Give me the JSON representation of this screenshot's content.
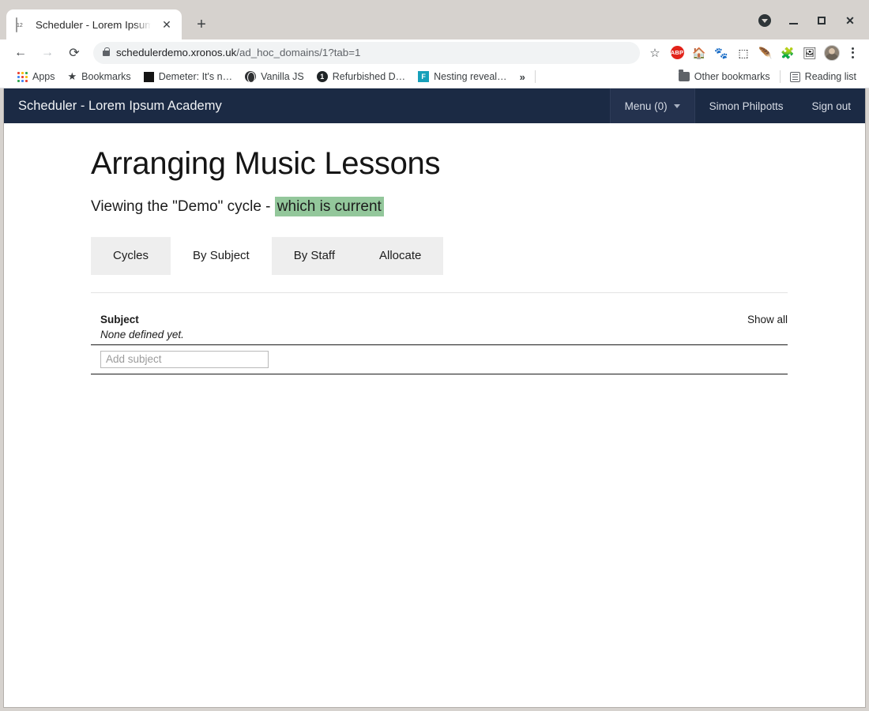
{
  "browser": {
    "tab": {
      "title": "Scheduler - Lorem Ipsum A",
      "favicon": "calendar-icon",
      "favicon_day": "12",
      "close_label": "✕"
    },
    "new_tab_label": "+",
    "window_controls": {
      "extra": "chevron-down-circle",
      "minimize": "—",
      "maximize": "□",
      "close": "✕"
    },
    "nav": {
      "back": "←",
      "forward": "→",
      "reload": "⟳"
    },
    "omnibox": {
      "lock": "lock-icon",
      "host": "schedulerdemo.xronos.uk",
      "path": "/ad_hoc_domains/1?tab=1",
      "star": "☆"
    },
    "extensions": [
      {
        "name": "adblock-plus-extension",
        "glyph": "ABP"
      },
      {
        "name": "house-extension",
        "glyph": "🏠"
      },
      {
        "name": "gnome-footprint-extension",
        "glyph": "🐾"
      },
      {
        "name": "screenshot-extension",
        "glyph": "⬚"
      },
      {
        "name": "feather-extension",
        "glyph": "🪶"
      },
      {
        "name": "puzzle-extensions-menu",
        "glyph": "🧩"
      },
      {
        "name": "cast-icon",
        "glyph": "⬜"
      }
    ],
    "profile": "avatar",
    "menu": "kebab-menu",
    "bookmarks": [
      {
        "name": "apps",
        "label": "Apps",
        "icon": "apps-grid-icon"
      },
      {
        "name": "bookmarks",
        "label": "Bookmarks",
        "icon": "star-icon"
      },
      {
        "name": "demeter",
        "label": "Demeter: It's n…",
        "icon": "black-square-icon"
      },
      {
        "name": "vanilla-js",
        "label": "Vanilla JS",
        "icon": "globe-icon"
      },
      {
        "name": "refurbished",
        "label": "Refurbished D…",
        "icon": "dark-circle-icon",
        "badge": "1"
      },
      {
        "name": "nesting",
        "label": "Nesting reveal…",
        "icon": "teal-square-icon",
        "badge": "F"
      }
    ],
    "overflow_label": "»",
    "other_bookmarks": "Other bookmarks",
    "reading_list": "Reading list"
  },
  "app": {
    "brand": "Scheduler - Lorem Ipsum Academy",
    "nav_right": [
      {
        "name": "menu",
        "label": "Menu (0)",
        "caret": true
      },
      {
        "name": "user",
        "label": "Simon Philpotts",
        "caret": false
      },
      {
        "name": "sign-out",
        "label": "Sign out",
        "caret": false
      }
    ]
  },
  "main": {
    "title": "Arranging Music Lessons",
    "subtitle_prefix": "Viewing the \"Demo\" cycle - ",
    "subtitle_highlight": "which is current",
    "highlight_color": "#93c79b",
    "tabs": [
      {
        "name": "cycles",
        "label": "Cycles",
        "active": false
      },
      {
        "name": "by-subject",
        "label": "By Subject",
        "active": true
      },
      {
        "name": "by-staff",
        "label": "By Staff",
        "active": false
      },
      {
        "name": "allocate",
        "label": "Allocate",
        "active": false
      }
    ],
    "table": {
      "header": "Subject",
      "show_all": "Show all",
      "empty_message": "None defined yet.",
      "add_placeholder": "Add subject",
      "add_value": ""
    }
  }
}
